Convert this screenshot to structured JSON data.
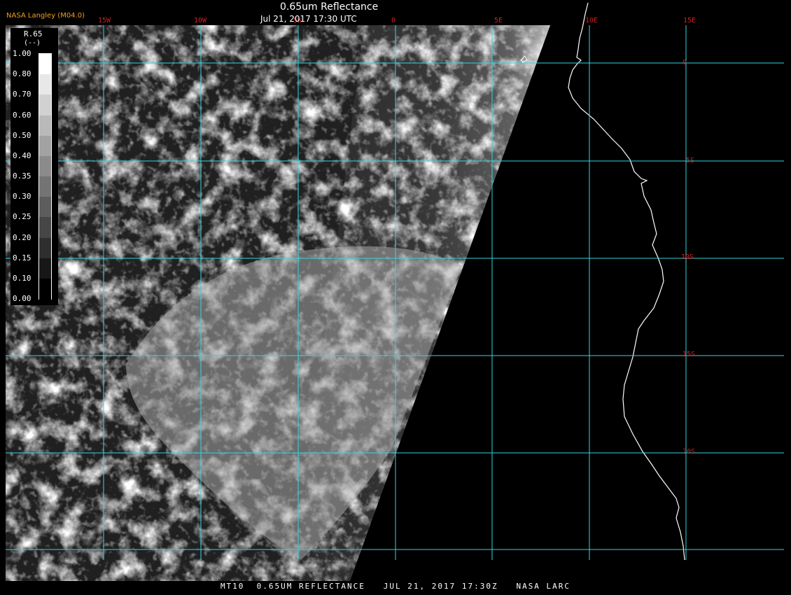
{
  "header": {
    "title": "0.65um Reflectance",
    "datetime": "Jul 21, 2017 17:30 UTC",
    "organization": "NASA Langley (M04.0)"
  },
  "footer": {
    "caption": "MT10  0.65UM REFLECTANCE   JUL 21, 2017 17:30Z   NASA LARC"
  },
  "colorbar": {
    "name": "R.65",
    "unit": "(--)",
    "ticks": [
      "1.00",
      "0.80",
      "0.70",
      "0.60",
      "0.50",
      "0.40",
      "0.35",
      "0.30",
      "0.25",
      "0.20",
      "0.15",
      "0.10",
      "0.00"
    ]
  },
  "grid": {
    "line_color": "#33d6e0",
    "label_color": "#d02020",
    "lon_labels": [
      "15W",
      "10W",
      "5W",
      "0",
      "5E",
      "10E",
      "15E"
    ],
    "lat_labels": [
      "0",
      "5S",
      "10S",
      "15S",
      "20S"
    ]
  },
  "colors": {
    "background": "#000000",
    "coastline": "#ffffff",
    "organization_text": "#f0a020"
  }
}
